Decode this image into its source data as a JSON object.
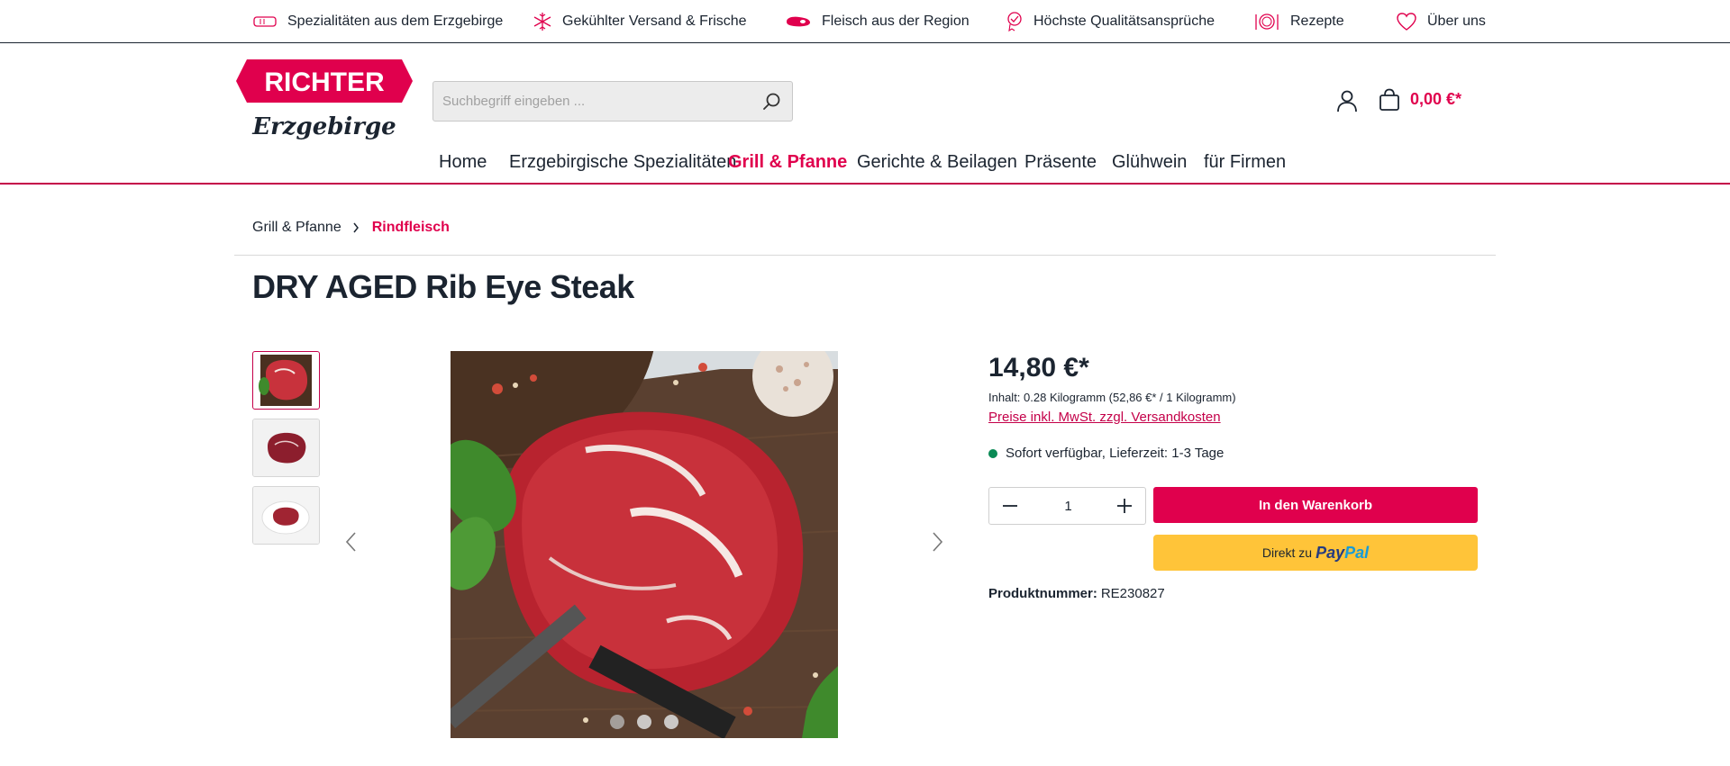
{
  "usp_bar": {
    "items": [
      {
        "icon": "sausage-icon",
        "label": "Spezialitäten aus dem Erzgebirge"
      },
      {
        "icon": "snowflake-icon",
        "label": "Gekühlter Versand & Frische"
      },
      {
        "icon": "meat-icon",
        "label": "Fleisch aus der Region"
      },
      {
        "icon": "quality-seal-icon",
        "label": "Höchste Qualitätsansprüche"
      },
      {
        "icon": "plate-cutlery-icon",
        "label": "Rezepte"
      },
      {
        "icon": "heart-icon",
        "label": "Über uns"
      }
    ]
  },
  "header": {
    "logo": {
      "brand": "RICHTER",
      "tagline": "Erzgebirge"
    },
    "search": {
      "placeholder": "Suchbegriff eingeben ..."
    },
    "cart_total": "0,00 €*"
  },
  "nav": {
    "items": [
      {
        "label": "Home",
        "active": false
      },
      {
        "label": "Erzgebirgische Spezialitäten",
        "active": false
      },
      {
        "label": "Grill & Pfanne",
        "active": true
      },
      {
        "label": "Gerichte & Beilagen",
        "active": false
      },
      {
        "label": "Präsente",
        "active": false
      },
      {
        "label": "Glühwein",
        "active": false
      },
      {
        "label": "für Firmen",
        "active": false
      }
    ]
  },
  "breadcrumb": {
    "items": [
      "Grill & Pfanne",
      "Rindfleisch"
    ]
  },
  "product": {
    "title": "DRY AGED Rib Eye Steak",
    "gallery": {
      "image_count": 3,
      "active_index": 0
    },
    "price": "14,80 €*",
    "unit_info": "Inhalt: 0.28 Kilogramm (52,86 €* / 1 Kilogramm)",
    "tax_link": "Preise inkl. MwSt. zzgl. Versandkosten",
    "delivery": "Sofort verfügbar, Lieferzeit: 1-3 Tage",
    "quantity": "1",
    "add_to_cart_label": "In den Warenkorb",
    "paypal": {
      "prefix": "Direkt zu",
      "brand_pay": "Pay",
      "brand_pal": "Pal"
    },
    "product_number_label": "Produktnummer:",
    "product_number": "RE230827"
  },
  "colors": {
    "brand": "#e0004d",
    "text": "#1b2430",
    "paypal_yellow": "#ffc439",
    "available_green": "#0a8a55"
  }
}
